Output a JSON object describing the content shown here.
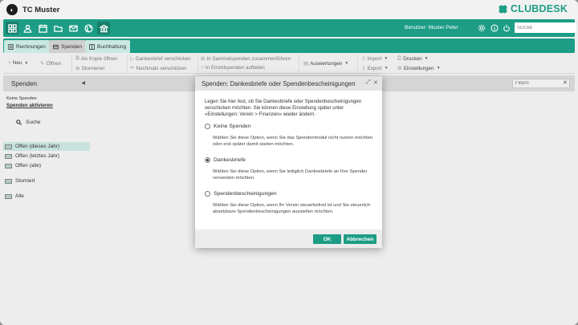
{
  "app": {
    "title": "TC Muster"
  },
  "header": {
    "user_label": "Benutzer: Muster Peter",
    "search_placeholder": "SUCHE",
    "brand": "CLUBDESK"
  },
  "tabs": [
    {
      "label": "Rechnungen"
    },
    {
      "label": "Spenden"
    },
    {
      "label": "Buchhaltung"
    }
  ],
  "toolbar": {
    "new": "Neu",
    "open": "Öffnen",
    "copy_open": "Als Kopie öffnen",
    "cancel": "Stornieren",
    "thanks_send": "Dankesbrief verschicken",
    "thanks_again": "Nochmals verschicken",
    "collective": "In Sammelspenden zusammenführen",
    "split": "In Einzelspenden aufteilen",
    "reports": "Auswertungen",
    "import": "Import",
    "export": "Export",
    "print": "Drucken",
    "settings": "Einstellungen"
  },
  "sidebar": {
    "title": "Spenden",
    "no_donations": "Keine Spenden",
    "activate_link": "Spenden aktivieren",
    "search": "Suche",
    "items": [
      {
        "label": "Offen (dieses Jahr)"
      },
      {
        "label": "Offen (letztes Jahr)"
      },
      {
        "label": "Offen (alle)"
      },
      {
        "label": "Storniert"
      },
      {
        "label": "Alle"
      }
    ]
  },
  "content": {
    "filter_placeholder": "Filtern"
  },
  "dialog": {
    "title": "Spenden: Dankesbriefe oder Spendenbescheinigungen",
    "intro": "Legen Sie hier fest, ob Sie Dankesbriefe oder Spendenbescheinigungen verschicken möchten. Sie können diese Einstellung später unter «Einstellungen: Verein > Finanzen» wieder ändern.",
    "options": [
      {
        "label": "Keine Spenden",
        "desc": "Wählen Sie diese Option, wenn Sie das Spendenmodul nicht nutzen möchten oder erst später damit starten möchten.",
        "checked": false
      },
      {
        "label": "Dankesbriefe",
        "desc": "Wählen Sie diese Option, wenn Sie lediglich Dankesbriefe an Ihre Spender versenden möchten.",
        "checked": true
      },
      {
        "label": "Spendenbescheinigungen",
        "desc": "Wählen Sie diese Option, wenn Ihr Verein steuerbefreit ist und Sie steuerlich absetzbare Spendenbescheinigungen ausstellen möchten.",
        "checked": false
      }
    ],
    "ok": "OK",
    "cancel": "Abbrechen"
  },
  "colors": {
    "accent": "#1d9d86",
    "sidebar_active": "#c8e2dc"
  }
}
